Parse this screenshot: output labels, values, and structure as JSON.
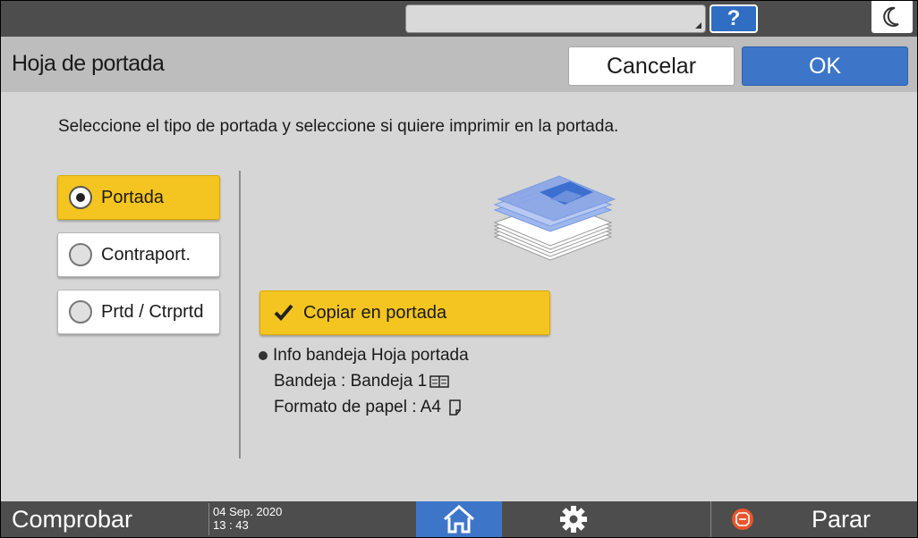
{
  "header": {
    "help_label": "?"
  },
  "titlebar": {
    "title": "Hoja de portada",
    "cancel_label": "Cancelar",
    "ok_label": "OK"
  },
  "main": {
    "instruction": "Seleccione el tipo de portada y seleccione si quiere imprimir en la portada.",
    "options": [
      {
        "label": "Portada",
        "selected": true
      },
      {
        "label": "Contraport.",
        "selected": false
      },
      {
        "label": "Prtd / Ctrprtd",
        "selected": false
      }
    ],
    "copy_label": "Copiar en portada",
    "copy_checked": true,
    "info_title": "Info bandeja Hoja portada",
    "tray_line": "Bandeja : Bandeja 1",
    "paper_line": "Formato de papel : A4"
  },
  "footer": {
    "status_label": "Comprobar estado",
    "date": "04 Sep. 2020",
    "time": "13 : 43",
    "stop_label": "Parar"
  },
  "colors": {
    "accent": "#3d76c9",
    "selected": "#f4c520",
    "stop": "#e8552e"
  },
  "icons": [
    "moon-icon",
    "home-icon",
    "gear-icon",
    "stop-icon",
    "tray-icon",
    "portrait-paper-icon",
    "checkmark-icon"
  ]
}
